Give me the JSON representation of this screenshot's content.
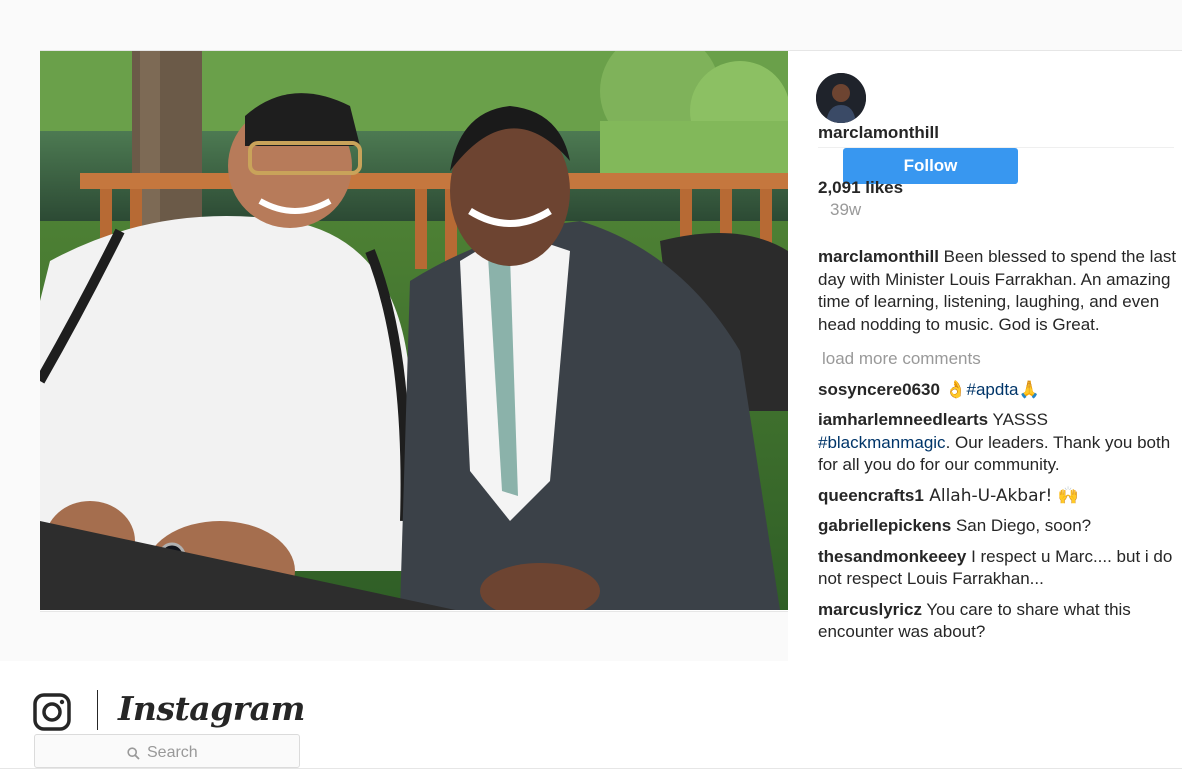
{
  "post": {
    "photo_alt": "Two men seated on a wooden deck in front of a pond",
    "author": {
      "username": "marclamonthill",
      "follow_label": "Follow"
    },
    "likes": "2,091 likes",
    "age": "39w",
    "caption": {
      "user": "marclamonthill",
      "text": " Been blessed to spend the last day with Minister Louis Farrakhan. An amazing time of learning, listening, laughing, and even head nodding to music. God is Great."
    },
    "load_more_label": "load more comments",
    "comments": [
      {
        "user": "sosyncere0630",
        "pre": " 👌",
        "tag": "#apdta",
        "post": "🙏"
      },
      {
        "user": "iamharlemneedlearts",
        "pre": " YASSS ",
        "tag": "#blackmanmagic",
        "post": ". Our leaders. Thank you both for all you do for our community."
      },
      {
        "user": "queencrafts1",
        "pre": " Allah-U-Akbar! 🙌",
        "tag": "",
        "post": ""
      },
      {
        "user": "gabriellepickens",
        "pre": " San Diego, soon?",
        "tag": "",
        "post": ""
      },
      {
        "user": "thesandmonkeeey",
        "pre": " I respect u Marc.... but i do not respect Louis Farrakhan...",
        "tag": "",
        "post": ""
      },
      {
        "user": "marcuslyricz",
        "pre": " You care to share what this encounter was about?",
        "tag": "",
        "post": ""
      }
    ]
  },
  "nav": {
    "brand": "Instagram",
    "search_placeholder": "Search"
  },
  "colors": {
    "accent": "#3897f0",
    "hashtag": "#003569",
    "muted": "#999999"
  },
  "icons": [
    "instagram-camera-icon",
    "search-icon"
  ]
}
